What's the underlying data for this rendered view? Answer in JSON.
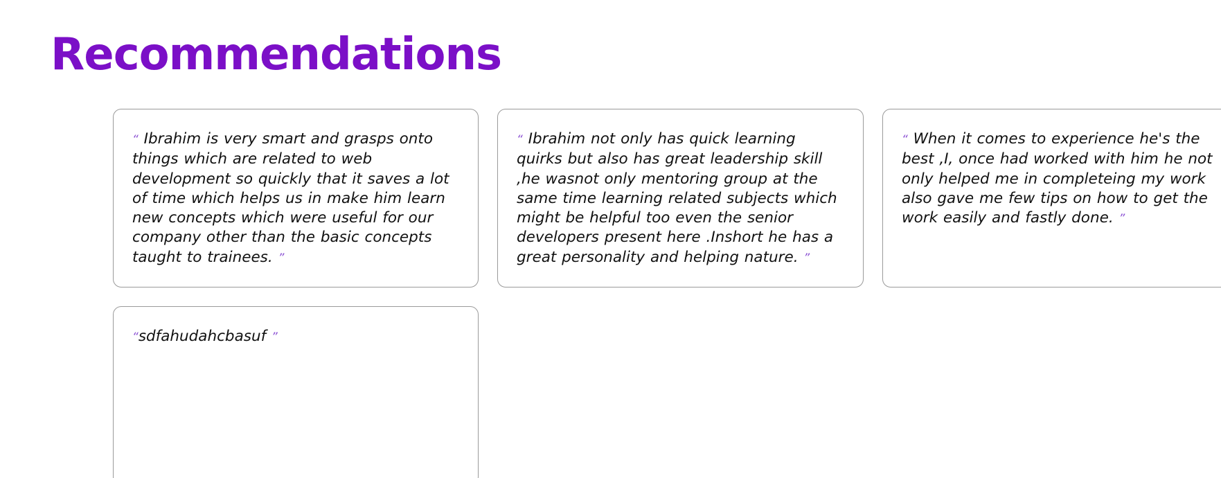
{
  "section": {
    "title": "Recommendations"
  },
  "quote_marks": {
    "open": "“",
    "close": "”"
  },
  "recommendations": [
    {
      "text": " Ibrahim is very smart and grasps onto things which are related to web development so quickly that it saves a lot of time which helps us in make him learn new concepts which were useful for our company other than the basic concepts taught to trainees. "
    },
    {
      "text": " Ibrahim not only has quick learning quirks but also has great leadership skill ,he wasnot only mentoring group at the same time learning related subjects which might be helpful too even the senior developers present here .Inshort he has a great personality and helping nature. "
    },
    {
      "text": " When it comes to experience he's the best ,I, once had worked with him he not only helped me in completeing my work also gave me few tips on how to get the work easily and fastly done. "
    },
    {
      "text": "sdfahudahcbasuf "
    }
  ],
  "colors": {
    "title": "#7b0fc7",
    "quote_mark": "#8a4fd3",
    "card_border": "#9a9a9a",
    "text": "#111111"
  }
}
